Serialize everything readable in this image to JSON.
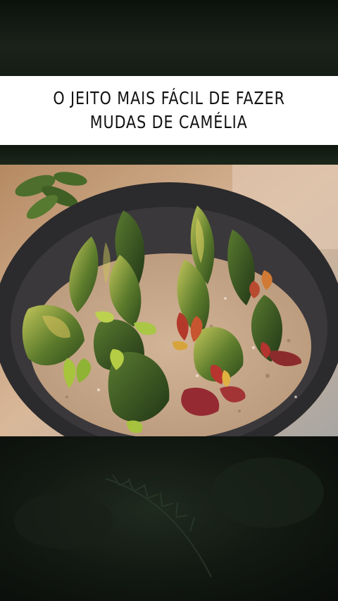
{
  "title": {
    "line1": "O JEITO MAIS FÁCIL DE FAZER",
    "line2": "MUDAS DE CAMÉLIA"
  },
  "colors": {
    "title_band": "#ffffff",
    "title_text": "#111111",
    "pot": "#2b2a2c",
    "soil": "#c9a889",
    "leaf_dark": "#3c5a22",
    "leaf_light": "#b5c24a",
    "new_growth": "#a8322e"
  },
  "image": {
    "subject": "camellia-cuttings-in-pot"
  }
}
